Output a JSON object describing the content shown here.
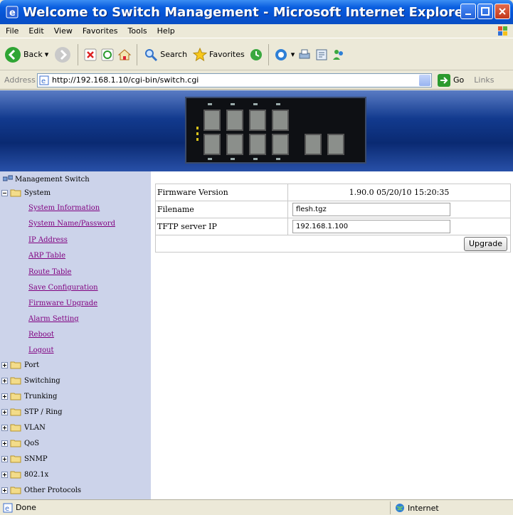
{
  "window": {
    "title": "Welcome to Switch Management - Microsoft Internet Explorer"
  },
  "menu": {
    "items": [
      "File",
      "Edit",
      "View",
      "Favorites",
      "Tools",
      "Help"
    ]
  },
  "toolbar": {
    "back_label": "Back",
    "search_label": "Search",
    "favorites_label": "Favorites"
  },
  "address": {
    "label": "Address",
    "url": "http://192.168.1.10/cgi-bin/switch.cgi",
    "go_label": "Go",
    "links_label": "Links"
  },
  "sidebar": {
    "root_label": "Management Switch",
    "system_label": "System",
    "system_items": [
      "System Information",
      "System Name/Password",
      "IP Address",
      "ARP Table",
      "Route Table",
      "Save Configuration",
      "Firmware Upgrade",
      "Alarm Setting",
      "Reboot",
      "Logout"
    ],
    "groups": [
      "Port",
      "Switching",
      "Trunking",
      "STP / Ring",
      "VLAN",
      "QoS",
      "SNMP",
      "802.1x",
      "Other Protocols"
    ]
  },
  "firmware": {
    "version_label": "Firmware Version",
    "version_value": "1.90.0 05/20/10 15:20:35",
    "filename_label": "Filename",
    "filename_value": "flesh.tgz",
    "tftp_label": "TFTP server IP",
    "tftp_value": "192.168.1.100",
    "upgrade_label": "Upgrade"
  },
  "status": {
    "left": "Done",
    "zone": "Internet"
  },
  "colors": {
    "title_bar": "#0653d4",
    "sidebar_bg": "#ccd3ea",
    "link_visited": "#800080"
  }
}
